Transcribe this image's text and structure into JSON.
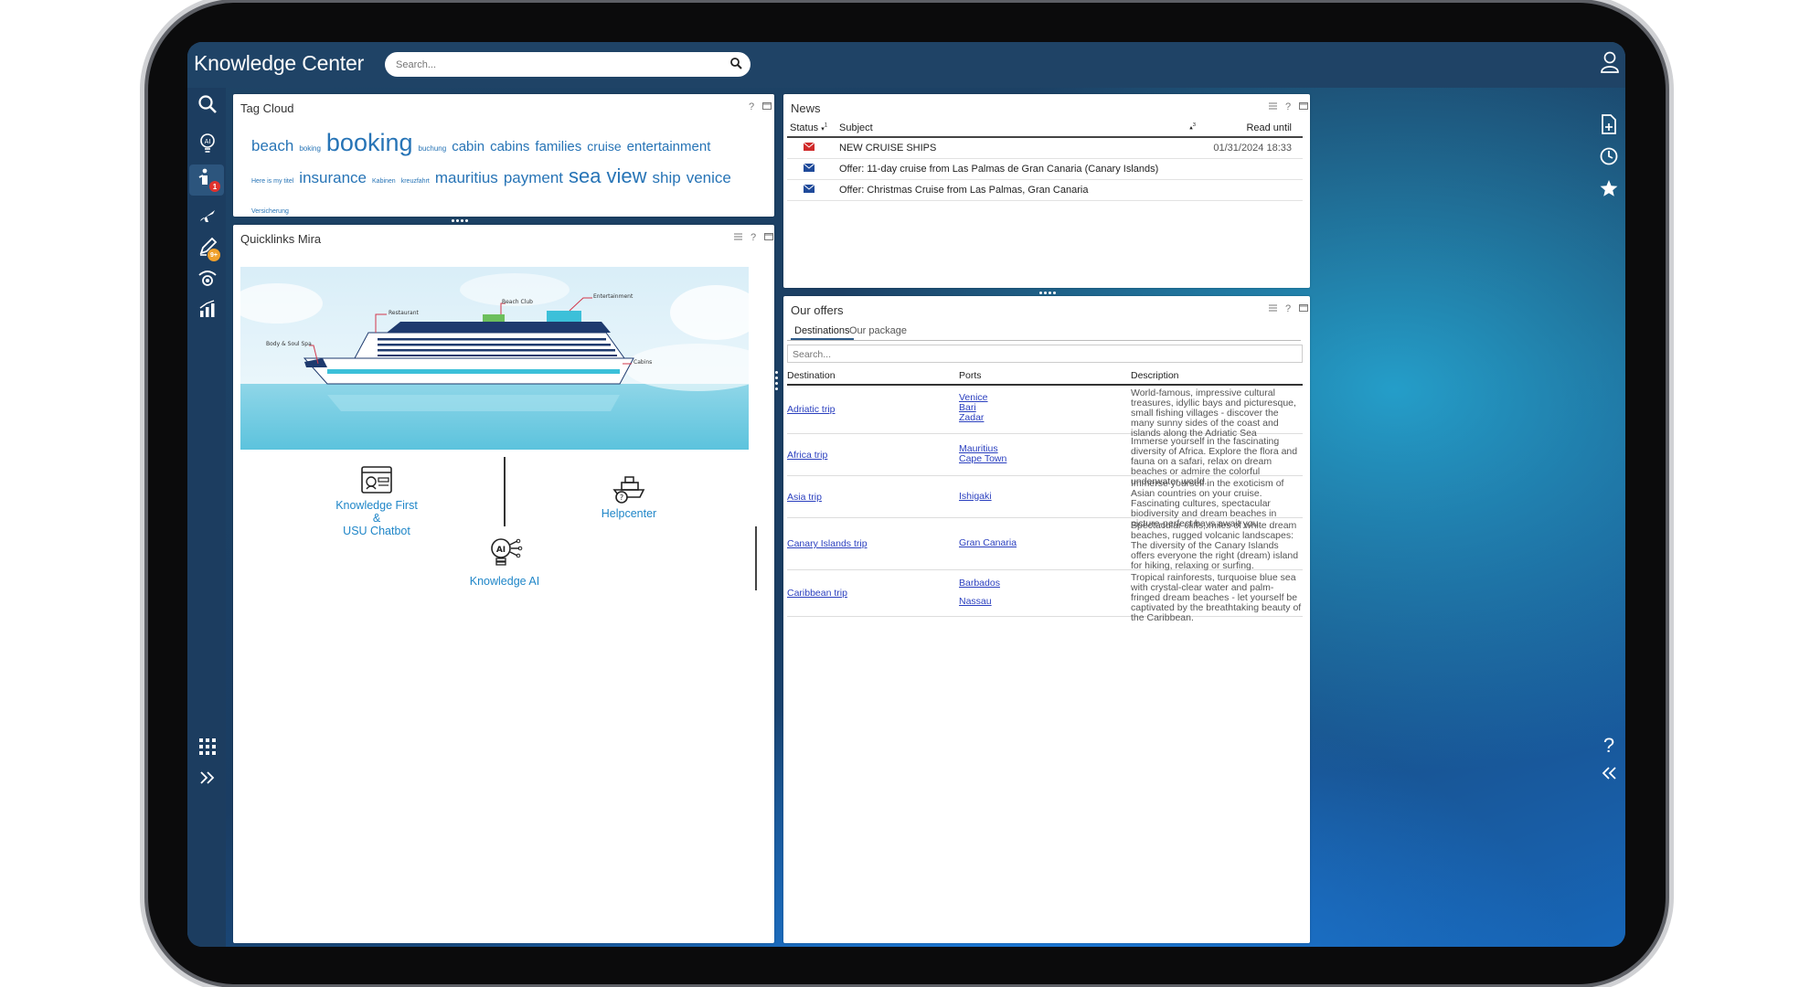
{
  "app": {
    "title": "Knowledge Center"
  },
  "search": {
    "placeholder": "Search..."
  },
  "tag_cloud": {
    "title": "Tag Cloud",
    "help": "?",
    "tags": [
      {
        "text": "beach",
        "size": 17
      },
      {
        "text": "boking",
        "size": 8
      },
      {
        "text": "booking",
        "size": 27
      },
      {
        "text": "buchung",
        "size": 8
      },
      {
        "text": "cabin",
        "size": 15
      },
      {
        "text": "cabins",
        "size": 15
      },
      {
        "text": "families",
        "size": 15
      },
      {
        "text": "cruise",
        "size": 14
      },
      {
        "text": "entertainment",
        "size": 15
      },
      {
        "text": "Here is my titel",
        "size": 7
      },
      {
        "text": "insurance",
        "size": 17
      },
      {
        "text": "Kabinen",
        "size": 7
      },
      {
        "text": "kreuzfahrt",
        "size": 7
      },
      {
        "text": "mauritius",
        "size": 17
      },
      {
        "text": "payment",
        "size": 17
      },
      {
        "text": "sea",
        "size": 22
      },
      {
        "text": "view",
        "size": 22
      },
      {
        "text": "ship",
        "size": 17
      },
      {
        "text": "venice",
        "size": 17
      },
      {
        "text": "Versicherung",
        "size": 7
      }
    ]
  },
  "quicklinks": {
    "title": "Quicklinks Mira",
    "help": "?",
    "ship_labels": [
      "Entertainment",
      "Beach Club",
      "Restaurant",
      "Body & Soul Spa",
      "Cabins"
    ],
    "items": [
      {
        "label_line1": "Knowledge First &",
        "label_line2": "USU Chatbot",
        "icon": "chatbot-icon"
      },
      {
        "label_line1": "Helpcenter",
        "label_line2": "",
        "icon": "helpcenter-ship-icon"
      },
      {
        "label_line1": "Knowledge AI",
        "label_line2": "",
        "icon": "ai-bulb-icon"
      }
    ]
  },
  "news": {
    "title": "News",
    "help": "?",
    "columns": {
      "status": "Status",
      "status_sort": "1",
      "subject": "Subject",
      "subject_sort": "3",
      "read_until": "Read until"
    },
    "rows": [
      {
        "subject": "NEW CRUISE SHIPS",
        "read_until": "01/31/2024 18:33",
        "status_color": "#d02a2a"
      },
      {
        "subject": "Offer: 11-day cruise from Las Palmas de Gran Canaria (Canary Islands)",
        "read_until": "",
        "status_color": "#1f4a9a"
      },
      {
        "subject": "Offer: Christmas Cruise from Las Palmas, Gran Canaria",
        "read_until": "",
        "status_color": "#1f4a9a"
      }
    ]
  },
  "offers": {
    "title": "Our offers",
    "help": "?",
    "tabs": [
      "Destinations",
      "Our package"
    ],
    "search_placeholder": "Search...",
    "columns": {
      "destination": "Destination",
      "ports": "Ports",
      "description": "Description"
    },
    "rows": [
      {
        "destination": "Adriatic trip",
        "ports": [
          "Venice",
          "Bari",
          "Zadar"
        ],
        "description": "World-famous, impressive cultural treasures, idyllic bays and picturesque, small fishing villages - discover the many sunny sides of the coast and islands along the Adriatic Sea"
      },
      {
        "destination": "Africa trip",
        "ports": [
          "Mauritius",
          "Cape Town"
        ],
        "description": "Immerse yourself in the fascinating diversity of Africa. Explore the flora and fauna on a safari, relax on dream beaches or admire the colorful underwater world."
      },
      {
        "destination": "Asia trip",
        "ports": [
          "Ishigaki"
        ],
        "description": "Immerse yourself in the exoticism of Asian countries on your cruise. Fascinating cultures, spectacular biodiversity and dream beaches in picture-perfect bays await you."
      },
      {
        "destination": "Canary Islands trip",
        "ports": [
          "Gran Canaria"
        ],
        "description": "Spectacular cliffs, miles of white dream beaches, rugged volcanic landscapes: The diversity of the Canary Islands offers everyone the right (dream) island for hiking, relaxing or surfing."
      },
      {
        "destination": "Caribbean trip",
        "ports": [
          "Barbados",
          "Nassau"
        ],
        "description": "Tropical rainforests, turquoise blue sea with crystal-clear water and palm-fringed dream beaches - let yourself be captivated by the breathtaking beauty of the Caribbean."
      }
    ]
  },
  "left_nav": {
    "messages_badge": "1",
    "tasks_badge": "9+"
  },
  "right_nav": {
    "help": "?"
  },
  "colors": {
    "brand": "#1f4366",
    "link": "#2774b6",
    "accent_badge": "#e0322e",
    "orange_badge": "#f0a02c"
  }
}
